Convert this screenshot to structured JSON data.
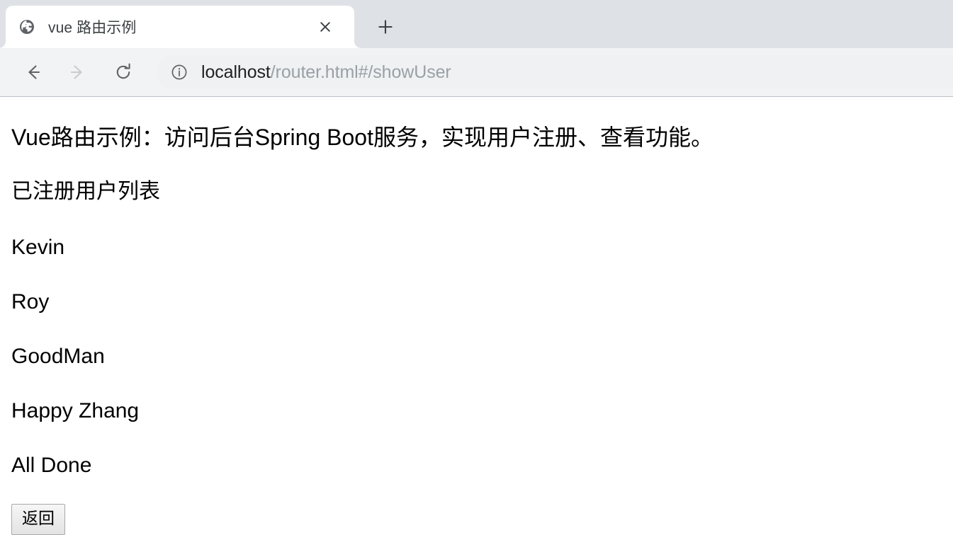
{
  "browser": {
    "tab": {
      "favicon": "globe-icon",
      "title": "vue 路由示例",
      "close_label": "✕"
    },
    "new_tab_label": "+",
    "nav": {
      "back_label": "←",
      "forward_label": "→",
      "reload_label": "⟳"
    },
    "omnibox": {
      "site_info_icon": "info-circle-icon",
      "url_host": "localhost",
      "url_path": "/router.html#/showUser",
      "url_full": "localhost/router.html#/showUser"
    }
  },
  "page": {
    "headline": "Vue路由示例：访问后台Spring Boot服务，实现用户注册、查看功能。",
    "subhead": "已注册用户列表",
    "users": [
      "Kevin",
      "Roy",
      "GoodMan",
      "Happy Zhang",
      "All Done"
    ],
    "back_button_label": "返回"
  },
  "colors": {
    "tabstrip_bg": "#dee1e6",
    "toolbar_bg": "#f1f3f4",
    "omnibox_bg": "#eff1f3",
    "text": "#000000",
    "url_muted": "#9aa0a6",
    "url_host": "#202124"
  }
}
